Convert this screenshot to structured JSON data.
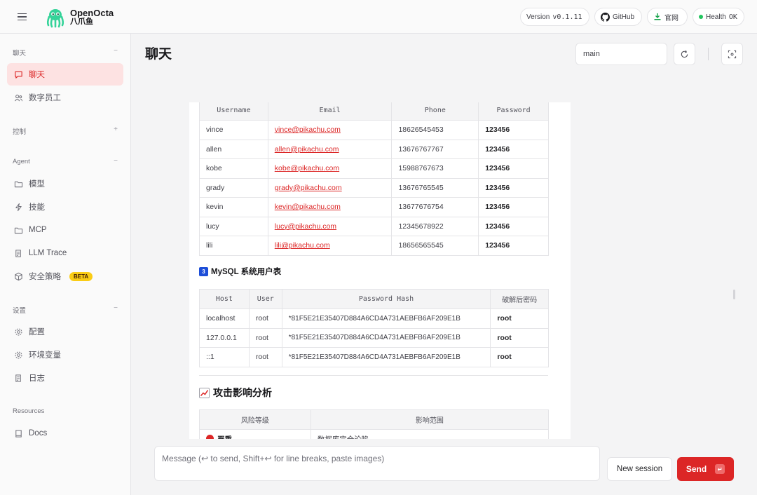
{
  "header": {
    "brand_name": "OpenOcta",
    "brand_sub": "八爪鱼",
    "version_label": "Version",
    "version_value": "v0.1.11",
    "github_label": "GitHub",
    "website_label": "官网",
    "health_label": "Health",
    "health_value": "OK"
  },
  "sidebar": {
    "sections": [
      {
        "title": "聊天",
        "toggle": "−",
        "items": [
          {
            "label": "聊天",
            "icon": "chat-icon"
          },
          {
            "label": "数字员工",
            "icon": "users-icon"
          }
        ]
      },
      {
        "title": "控制",
        "toggle": "+",
        "items": []
      },
      {
        "title": "Agent",
        "toggle": "−",
        "items": [
          {
            "label": "模型",
            "icon": "folder-icon"
          },
          {
            "label": "技能",
            "icon": "bolt-icon"
          },
          {
            "label": "MCP",
            "icon": "folder-icon"
          },
          {
            "label": "LLM Trace",
            "icon": "scroll-icon"
          },
          {
            "label": "安全策略",
            "icon": "cube-icon",
            "badge": "BETA"
          }
        ]
      },
      {
        "title": "设置",
        "toggle": "−",
        "items": [
          {
            "label": "配置",
            "icon": "gear-icon"
          },
          {
            "label": "环境变量",
            "icon": "gear-icon"
          },
          {
            "label": "日志",
            "icon": "scroll-icon"
          }
        ]
      },
      {
        "title": "Resources",
        "toggle": "",
        "items": [
          {
            "label": "Docs",
            "icon": "book-icon"
          }
        ]
      }
    ]
  },
  "main": {
    "title": "聊天",
    "session_value": "main"
  },
  "users_table": {
    "headers": [
      "Username",
      "Email",
      "Phone",
      "Password"
    ],
    "rows": [
      [
        "vince",
        "vince@pikachu.com",
        "18626545453",
        "123456"
      ],
      [
        "allen",
        "allen@pikachu.com",
        "13676767767",
        "123456"
      ],
      [
        "kobe",
        "kobe@pikachu.com",
        "15988767673",
        "123456"
      ],
      [
        "grady",
        "grady@pikachu.com",
        "13676765545",
        "123456"
      ],
      [
        "kevin",
        "kevin@pikachu.com",
        "13677676754",
        "123456"
      ],
      [
        "lucy",
        "lucy@pikachu.com",
        "12345678922",
        "123456"
      ],
      [
        "lili",
        "lili@pikachu.com",
        "18656565545",
        "123456"
      ]
    ]
  },
  "mysql_section": {
    "number": "3",
    "title": "MySQL 系统用户表",
    "headers": [
      "Host",
      "User",
      "Password Hash",
      "破解后密码"
    ],
    "rows": [
      [
        "localhost",
        "root",
        "*81F5E21E35407D884A6CD4A731AEBFB6AF209E1B",
        "root"
      ],
      [
        "127.0.0.1",
        "root",
        "*81F5E21E35407D884A6CD4A731AEBFB6AF209E1B",
        "root"
      ],
      [
        "::1",
        "root",
        "*81F5E21E35407D884A6CD4A731AEBFB6AF209E1B",
        "root"
      ]
    ]
  },
  "impact_section": {
    "title": "攻击影响分析",
    "headers": [
      "风险等级",
      "影响范围"
    ],
    "first_row": [
      "严重",
      "数据库完全沦陷"
    ]
  },
  "composer": {
    "placeholder": "Message (↩ to send, Shift+↩ for line breaks, paste images)",
    "new_session_label": "New session",
    "send_label": "Send",
    "send_key": "↵"
  },
  "colors": {
    "accent": "#dc2626",
    "health_dot": "#22c55e",
    "beta_badge": "#facc15"
  }
}
